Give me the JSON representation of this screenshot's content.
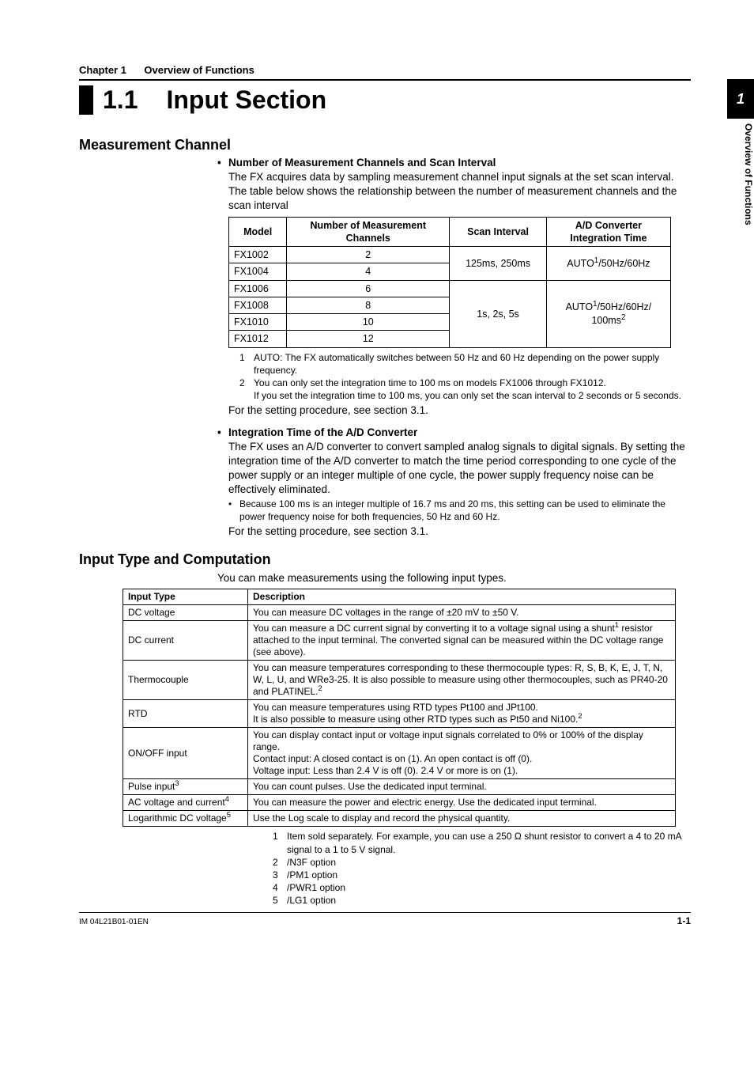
{
  "sideTab": {
    "num": "1",
    "label": "Overview of Functions"
  },
  "chapter": {
    "num": "Chapter 1",
    "title": "Overview of Functions"
  },
  "h1": {
    "num": "1.1",
    "title": "Input Section"
  },
  "mc": {
    "heading": "Measurement Channel",
    "b1_title": "Number of Measurement Channels and Scan Interval",
    "b1_text": "The FX acquires data by sampling measurement channel input signals at the set scan interval. The table below shows the relationship between the number of measurement channels and the scan interval",
    "table": {
      "h_model": "Model",
      "h_chan_1": "Number of Measurement",
      "h_chan_2": "Channels",
      "h_scan": "Scan Interval",
      "h_ad_1": "A/D Converter",
      "h_ad_2": "Integration Time",
      "r1": {
        "model": "FX1002",
        "ch": "2"
      },
      "r2": {
        "model": "FX1004",
        "ch": "4"
      },
      "scan_a": "125ms, 250ms",
      "ad_a_1": "AUTO",
      "ad_a_2": "/50Hz/60Hz",
      "r3": {
        "model": "FX1006",
        "ch": "6"
      },
      "r4": {
        "model": "FX1008",
        "ch": "8"
      },
      "r5": {
        "model": "FX1010",
        "ch": "10"
      },
      "r6": {
        "model": "FX1012",
        "ch": "12"
      },
      "scan_b": "1s, 2s, 5s",
      "ad_b_1": "AUTO",
      "ad_b_2": "/50Hz/60Hz/",
      "ad_b_3": "100ms"
    },
    "fn1": "AUTO: The FX automatically switches between 50 Hz and 60 Hz depending on the power supply frequency.",
    "fn2_a": "You can only set the integration time to 100 ms on models FX1006 through FX1012.",
    "fn2_b": "If you set the integration time to 100 ms, you can only set the scan interval to 2 seconds or 5 seconds.",
    "see1": "For the setting procedure, see section 3.1.",
    "b2_title": "Integration Time of the A/D Converter",
    "b2_text": "The FX uses an A/D converter to convert sampled analog signals to digital signals. By setting the integration time of the A/D converter to match the time period corresponding to one cycle of the power supply or an integer multiple of one cycle, the power supply frequency noise can be effectively eliminated.",
    "sb1": "Because 100 ms is an integer multiple of 16.7 ms and 20 ms, this setting can be used to eliminate the power frequency noise for both frequencies, 50 Hz and 60 Hz.",
    "see2": "For the setting procedure, see section 3.1."
  },
  "itc": {
    "heading": "Input Type and Computation",
    "intro": "You can make measurements using the following input types.",
    "h_type": "Input Type",
    "h_desc": "Description",
    "rows": {
      "dcv_t": "DC voltage",
      "dcv_d": "You can measure DC voltages in the range of ±20 mV to ±50 V.",
      "dcc_t": "DC current",
      "dcc_d1": "You can measure a DC current signal by converting it to a voltage signal using a shunt",
      "dcc_d2": " resistor attached to the input terminal. The converted signal can be measured within the DC voltage range (see above).",
      "tc_t": "Thermocouple",
      "tc_d1": "You can measure temperatures corresponding to these thermocouple types: R, S, B, K, E, J, T, N, W, L, U, and WRe3-25. It is also possible to measure using other thermocouples, such as PR40-20 and PLATINEL.",
      "rtd_t": "RTD",
      "rtd_d1": "You can measure temperatures using RTD types Pt100 and JPt100.",
      "rtd_d2": "It is also possible to measure using other RTD types such as Pt50 and Ni100.",
      "on_t": "ON/OFF input",
      "on_d1": "You can display contact input or voltage input signals correlated to 0% or 100% of the display range.",
      "on_d2": "Contact input: A closed contact is on (1). An open contact is off (0).",
      "on_d3": "Voltage input: Less than 2.4 V is off (0). 2.4 V or more is on (1).",
      "pu_t": "Pulse input",
      "pu_d": "You can count pulses. Use the dedicated input terminal.",
      "ac_t": "AC voltage and current",
      "ac_d": "You can measure the power and electric energy. Use the dedicated input terminal.",
      "log_t": "Logarithmic DC voltage",
      "log_d": "Use the Log scale to display and record the physical quantity."
    },
    "fn1": "Item sold separately. For example, you can use a 250 Ω shunt resistor to convert a 4 to 20 mA signal to a 1 to 5 V signal.",
    "fn2": "/N3F option",
    "fn3": "/PM1 option",
    "fn4": "/PWR1 option",
    "fn5": "/LG1 option"
  },
  "footer": {
    "left": "IM 04L21B01-01EN",
    "right": "1-1"
  }
}
